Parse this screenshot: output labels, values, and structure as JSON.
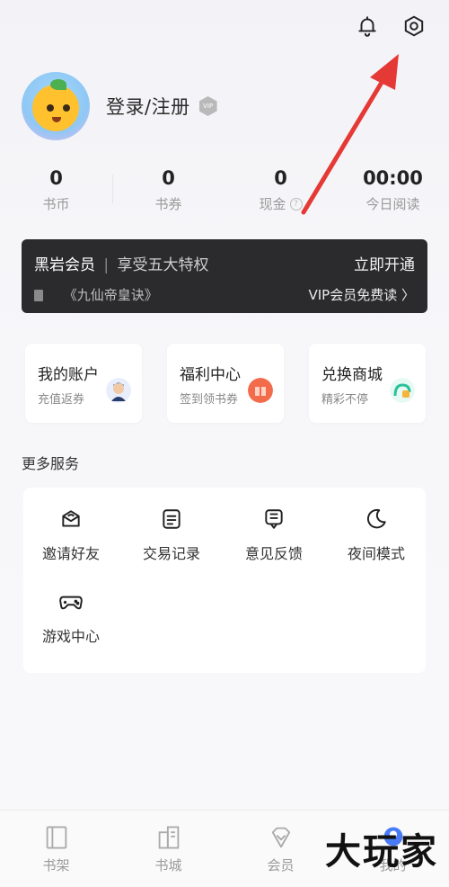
{
  "profile": {
    "login_text": "登录/注册",
    "vip_badge": "VIP"
  },
  "stats": [
    {
      "value": "0",
      "label": "书币"
    },
    {
      "value": "0",
      "label": "书券"
    },
    {
      "value": "0",
      "label": "现金"
    },
    {
      "value": "00:00",
      "label": "今日阅读"
    }
  ],
  "vip_card": {
    "title": "黑岩会员",
    "separator": "|",
    "subtitle": "享受五大特权",
    "open_button": "立即开通",
    "book": "《九仙帝皇诀》",
    "free_read": "VIP会员免费读 〉"
  },
  "quick_cards": [
    {
      "title": "我的账户",
      "subtitle": "充值返券"
    },
    {
      "title": "福利中心",
      "subtitle": "签到领书券"
    },
    {
      "title": "兑换商城",
      "subtitle": "精彩不停"
    }
  ],
  "more_services": {
    "title": "更多服务",
    "items": [
      {
        "label": "邀请好友",
        "icon": "invite-icon"
      },
      {
        "label": "交易记录",
        "icon": "transaction-icon"
      },
      {
        "label": "意见反馈",
        "icon": "feedback-icon"
      },
      {
        "label": "夜间模式",
        "icon": "moon-icon"
      },
      {
        "label": "游戏中心",
        "icon": "gamepad-icon"
      }
    ]
  },
  "bottom_nav": [
    {
      "label": "书架"
    },
    {
      "label": "书城"
    },
    {
      "label": "会员"
    },
    {
      "label": "我的"
    }
  ],
  "watermark": "大玩家",
  "colors": {
    "vip_card_bg": "#2b2b2d",
    "arrow": "#e53935",
    "page_bg": "#f5f5f8"
  }
}
